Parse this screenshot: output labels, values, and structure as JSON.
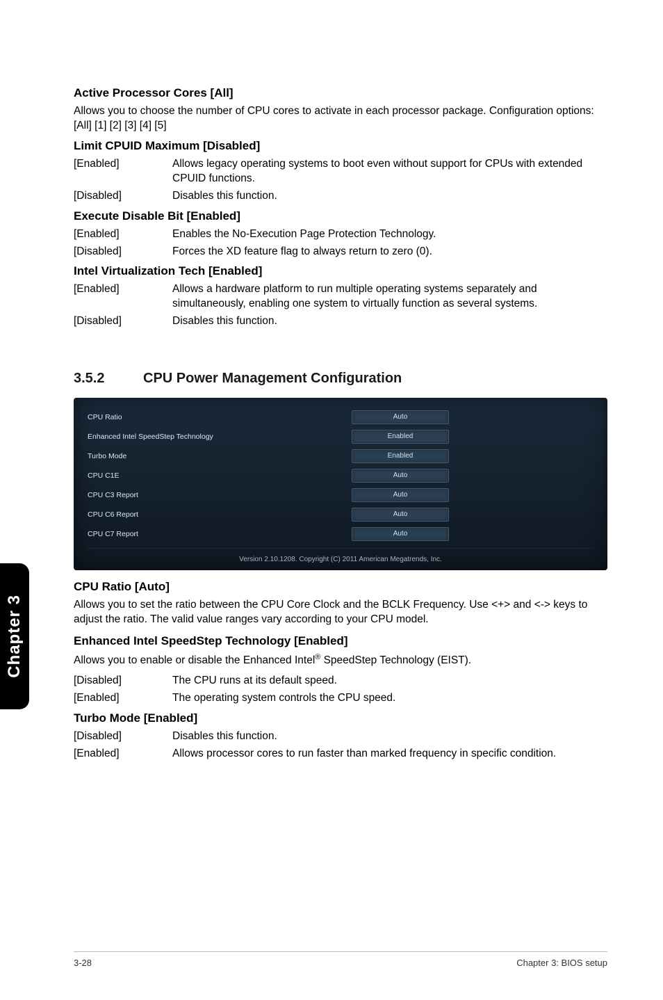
{
  "sections": {
    "active_cores": {
      "title": "Active Processor Cores [All]",
      "desc": "Allows you to choose the number of CPU cores to activate in each processor package. Configuration options: [All] [1] [2] [3] [4] [5]"
    },
    "limit_cpuid": {
      "title": "Limit CPUID Maximum [Disabled]",
      "rows": [
        {
          "k": "[Enabled]",
          "v": "Allows legacy operating systems to boot even without support for CPUs with extended CPUID functions."
        },
        {
          "k": "[Disabled]",
          "v": "Disables this function."
        }
      ]
    },
    "exec_disable": {
      "title": "Execute Disable Bit [Enabled]",
      "rows": [
        {
          "k": "[Enabled]",
          "v": "Enables the No-Execution Page Protection Technology."
        },
        {
          "k": "[Disabled]",
          "v": "Forces the XD feature flag to always return to zero (0)."
        }
      ]
    },
    "intel_virt": {
      "title": "Intel Virtualization Tech [Enabled]",
      "rows": [
        {
          "k": "[Enabled]",
          "v": "Allows a hardware platform to run multiple operating systems separately and simultaneously, enabling one system to virtually function as several systems."
        },
        {
          "k": "[Disabled]",
          "v": "Disables this function."
        }
      ]
    }
  },
  "section_352": {
    "num": "3.5.2",
    "title": "CPU Power Management Configuration"
  },
  "bios": {
    "rows": [
      {
        "label": "CPU Ratio",
        "value": "Auto"
      },
      {
        "label": "Enhanced Intel SpeedStep Technology",
        "value": "Enabled"
      },
      {
        "label": "Turbo Mode",
        "value": "Enabled"
      },
      {
        "label": "CPU C1E",
        "value": "Auto"
      },
      {
        "label": "CPU C3 Report",
        "value": "Auto"
      },
      {
        "label": "CPU C6 Report",
        "value": "Auto"
      },
      {
        "label": "CPU C7 Report",
        "value": "Auto"
      }
    ],
    "footer": "Version 2.10.1208.  Copyright (C) 2011 American Megatrends, Inc."
  },
  "cpu_ratio": {
    "title": "CPU Ratio [Auto]",
    "desc": "Allows you to set the ratio between the CPU Core Clock and the BCLK Frequency. Use <+> and <-> keys to adjust the ratio. The valid value ranges vary according to your CPU model."
  },
  "eist": {
    "title": "Enhanced Intel SpeedStep Technology [Enabled]",
    "desc_pre": "Allows you to enable or disable the Enhanced Intel",
    "desc_post": " SpeedStep Technology (EIST).",
    "rows": [
      {
        "k": "[Disabled]",
        "v": "The CPU runs at its default speed."
      },
      {
        "k": "[Enabled]",
        "v": "The operating system controls the CPU speed."
      }
    ]
  },
  "turbo": {
    "title": "Turbo Mode [Enabled]",
    "rows": [
      {
        "k": "[Disabled]",
        "v": "Disables this function."
      },
      {
        "k": "[Enabled]",
        "v": "Allows processor cores to run faster than marked frequency in specific condition."
      }
    ]
  },
  "side_tab": "Chapter 3",
  "footer": {
    "left": "3-28",
    "right": "Chapter 3: BIOS setup"
  }
}
